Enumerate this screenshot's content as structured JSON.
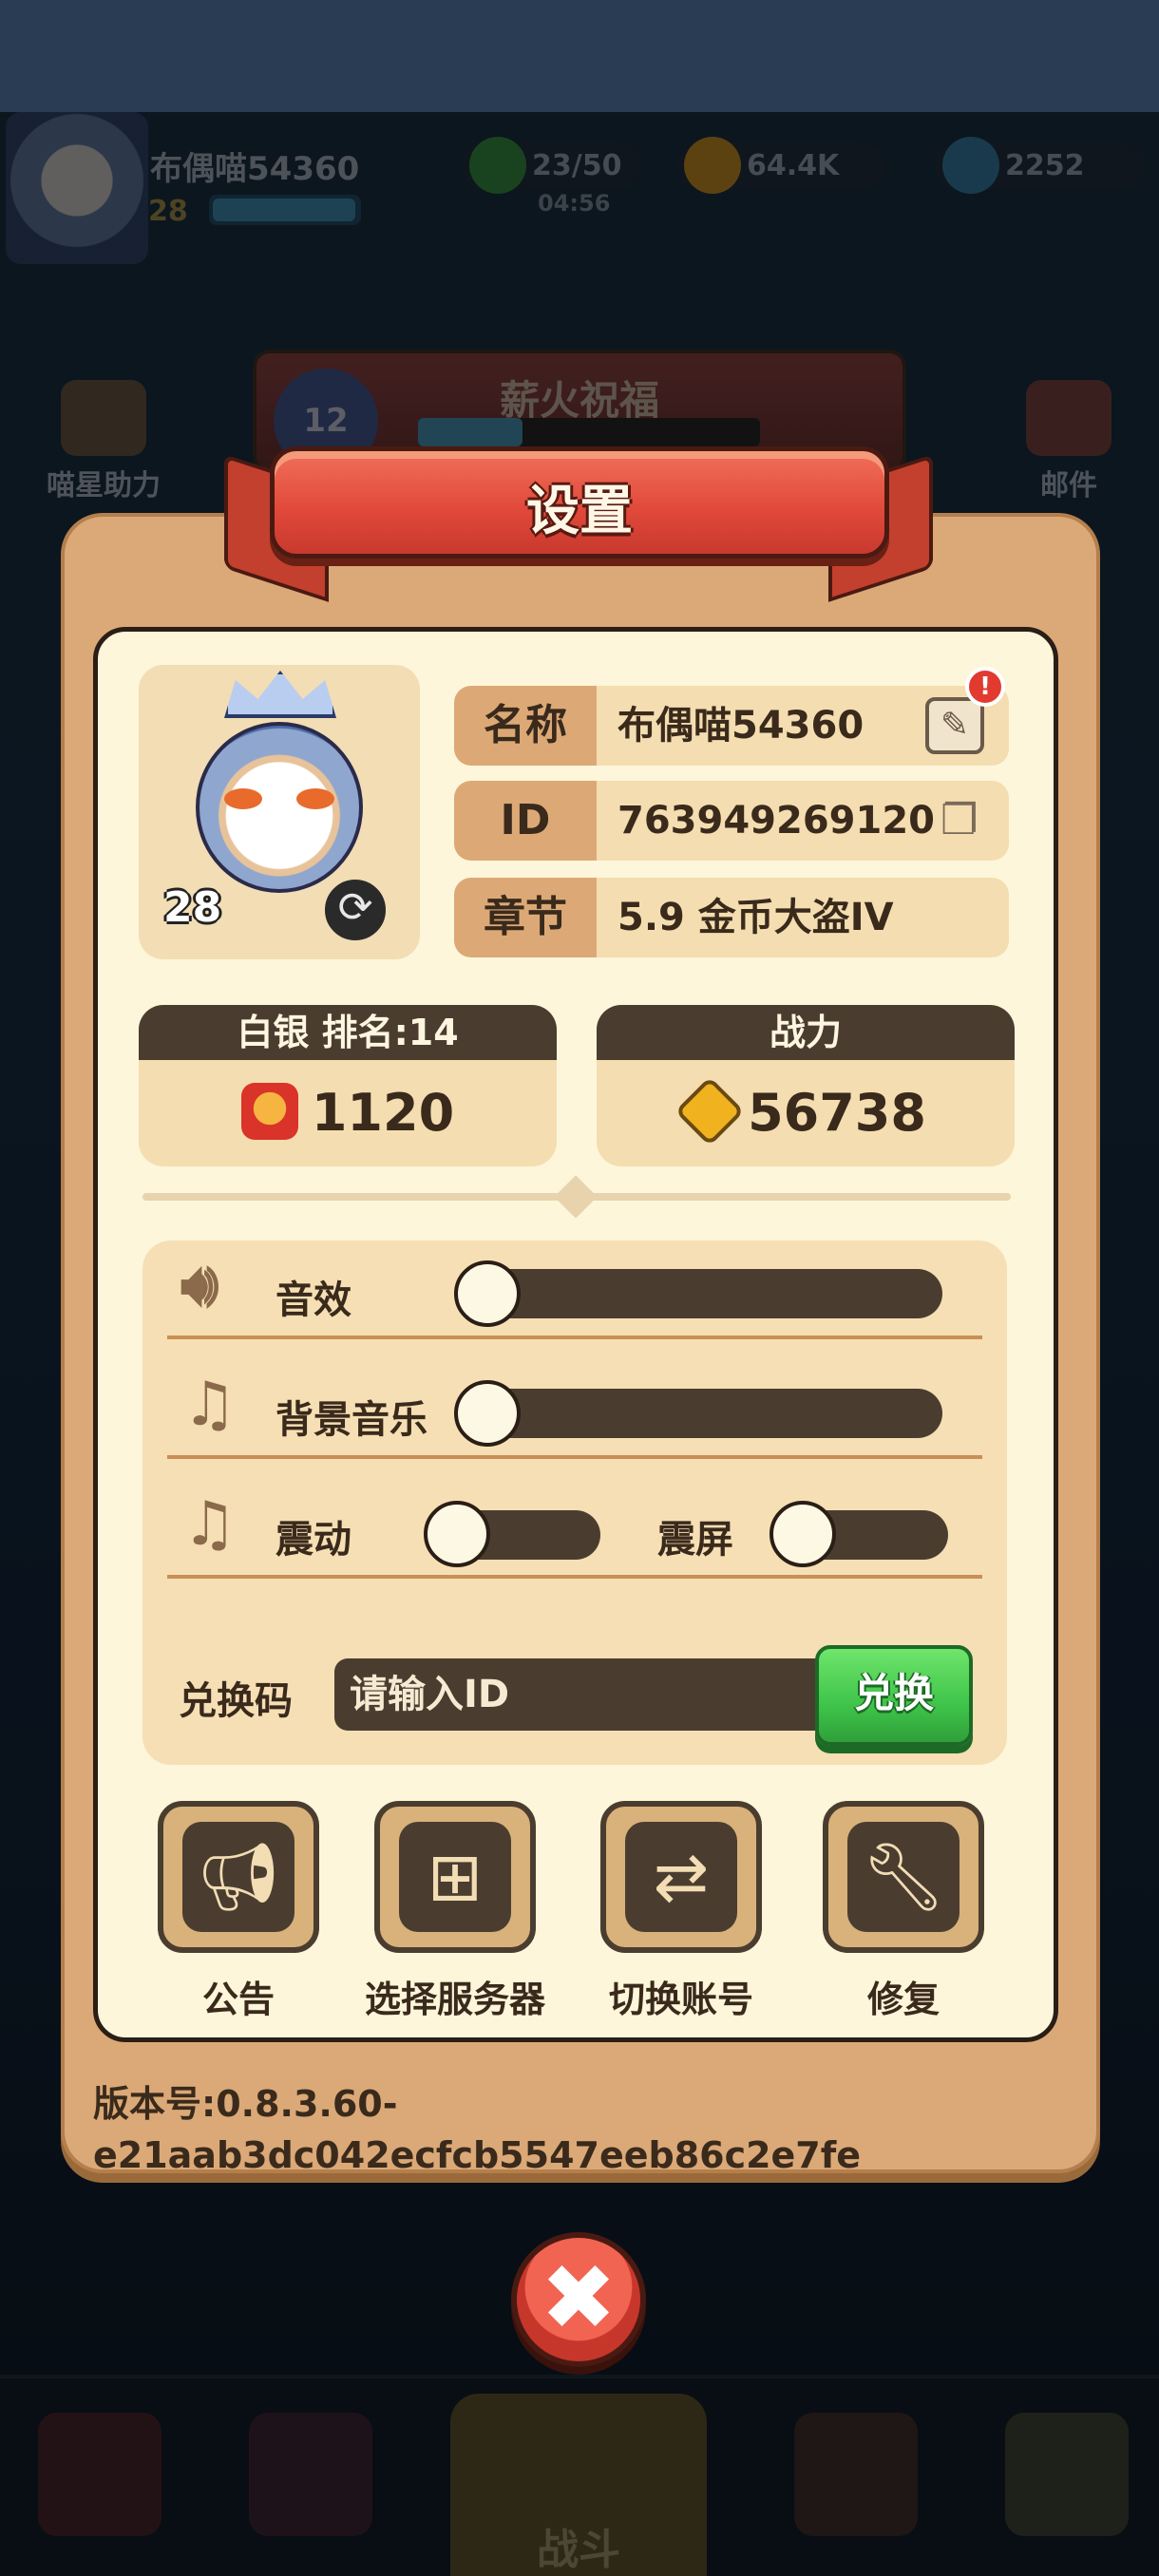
{
  "hud": {
    "player_name": "布偶喵54360",
    "level": "28",
    "stamina": "23/50",
    "stamina_timer": "04:56",
    "gold": "64.4K",
    "gems": "2252",
    "left_side_label": "喵星助力",
    "right_side_label": "邮件",
    "event_title": "薪火祝福",
    "event_level": "12",
    "battle_label": "战斗"
  },
  "dialog": {
    "title": "设置",
    "profile": {
      "level": "28",
      "name_label": "名称",
      "name_value": "布偶喵54360",
      "id_label": "ID",
      "id_value": "763949269120",
      "chapter_label": "章节",
      "chapter_value": "5.9 金币大盗IV",
      "alert": "!"
    },
    "rank_card": {
      "header": "白银  排名:14",
      "value": "1120"
    },
    "power_card": {
      "header": "战力",
      "value": "56738"
    },
    "settings": {
      "sound_label": "音效",
      "sound_level": 0,
      "music_label": "背景音乐",
      "music_level": 0,
      "vibration_label": "震动",
      "vibration_on": false,
      "shake_label": "震屏",
      "shake_on": false
    },
    "redeem": {
      "label": "兑换码",
      "placeholder": "请输入ID",
      "button": "兑换"
    },
    "actions": [
      {
        "label": "公告",
        "icon": "megaphone-icon"
      },
      {
        "label": "选择服务器",
        "icon": "server-icon"
      },
      {
        "label": "切换账号",
        "icon": "switch-account-icon"
      },
      {
        "label": "修复",
        "icon": "wrench-icon"
      }
    ],
    "version_line1": "版本号:0.8.3.60-",
    "version_line2": "e21aab3dc042ecfcb5547eeb86c2e7fe"
  },
  "colors": {
    "panel": "#dba977",
    "inner": "#fdf6da",
    "ribbon": "#e24a3b",
    "dark": "#4a3d30",
    "green": "#3fc44a"
  }
}
